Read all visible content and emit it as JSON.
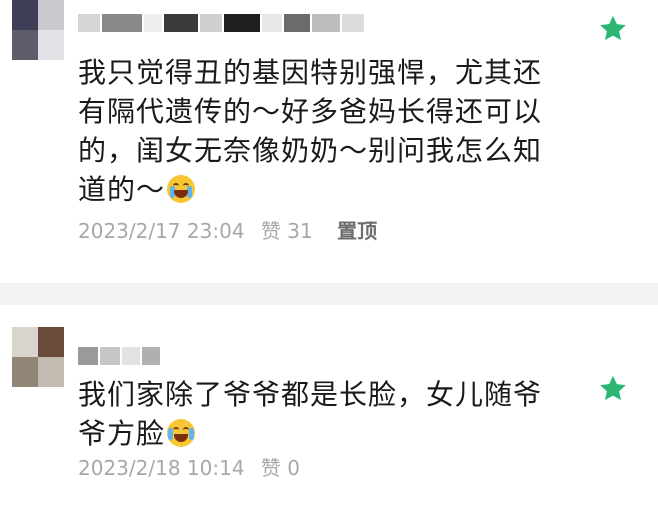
{
  "comments": [
    {
      "text": "我只觉得丑的基因特别强悍，尤其还有隔代遗传的～好多爸妈长得还可以的，闺女无奈像奶奶～别问我怎么知道的～",
      "emoji": "crying-face-emoji",
      "time": "2023/2/17 23:04",
      "likes": "赞 31",
      "pin_label": "置顶",
      "starred": true,
      "star_color": "#2bb673"
    },
    {
      "text": "我们家除了爷爷都是长脸，女儿随爷爷方脸",
      "emoji": "laughing-tears-emoji",
      "time": "2023/2/18 10:14",
      "likes": "赞 0",
      "starred": true,
      "star_color": "#2bb673"
    }
  ]
}
